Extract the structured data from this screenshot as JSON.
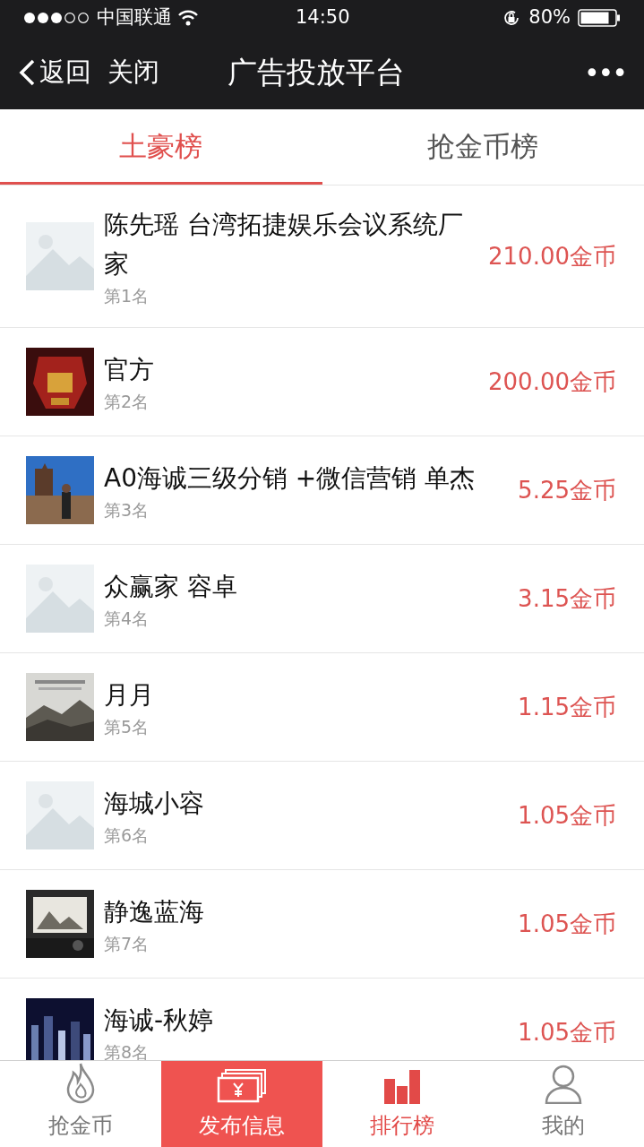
{
  "status_bar": {
    "carrier": "中国联通",
    "time": "14:50",
    "battery": "80%"
  },
  "nav": {
    "back": "返回",
    "close": "关闭",
    "title": "广告投放平台",
    "more": "•••"
  },
  "tabs": [
    {
      "label": "土豪榜",
      "selected": true
    },
    {
      "label": "抢金币榜",
      "selected": false
    }
  ],
  "rows": [
    {
      "name": "陈先瑶 台湾拓捷娱乐会议系统厂家",
      "rank": "第1名",
      "amount": "210.00金币"
    },
    {
      "name": "官方",
      "rank": "第2名",
      "amount": "200.00金币"
    },
    {
      "name": "A0海诚三级分销 +微信营销 单杰",
      "rank": "第3名",
      "amount": "5.25金币"
    },
    {
      "name": "众赢家 容卓",
      "rank": "第4名",
      "amount": "3.15金币"
    },
    {
      "name": "月月",
      "rank": "第5名",
      "amount": "1.15金币"
    },
    {
      "name": "海城小容",
      "rank": "第6名",
      "amount": "1.05金币"
    },
    {
      "name": "静逸蓝海",
      "rank": "第7名",
      "amount": "1.05金币"
    },
    {
      "name": "海诚-秋婷",
      "rank": "第8名",
      "amount": "1.05金币"
    }
  ],
  "tab_bar": [
    {
      "kind": "tab",
      "label": "抢金币",
      "selected": false
    },
    {
      "kind": "publish",
      "label": "发布信息"
    },
    {
      "kind": "tab",
      "label": "排行榜",
      "selected": true
    },
    {
      "kind": "tab",
      "label": "我的",
      "selected": false
    }
  ]
}
